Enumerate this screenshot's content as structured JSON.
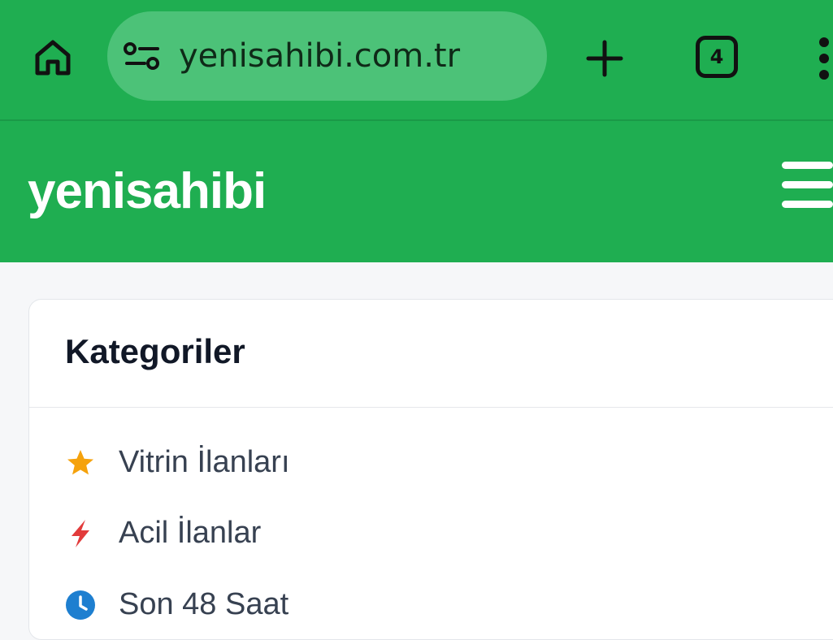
{
  "browser": {
    "url": "yenisahibi.com.tr",
    "tab_count": "4",
    "icons": {
      "home": "home-icon",
      "site_settings": "site-settings-icon",
      "new_tab": "plus-icon",
      "tabs": "tab-switcher-icon",
      "menu": "more-vertical-icon"
    },
    "bar_color": "#1fae51",
    "omnibox_color": "#4cc278"
  },
  "site": {
    "brand": "yenisahibi",
    "header_color": "#1fae51",
    "menu_icon": "hamburger-icon"
  },
  "categories": {
    "title": "Kategoriler",
    "items": [
      {
        "label": "Vitrin İlanları",
        "icon": "star-icon",
        "color": "#f5a20c"
      },
      {
        "label": "Acil İlanlar",
        "icon": "lightning-icon",
        "color": "#e23b3b"
      },
      {
        "label": "Son 48 Saat",
        "icon": "clock-icon",
        "color": "#1e7fd0"
      }
    ]
  }
}
